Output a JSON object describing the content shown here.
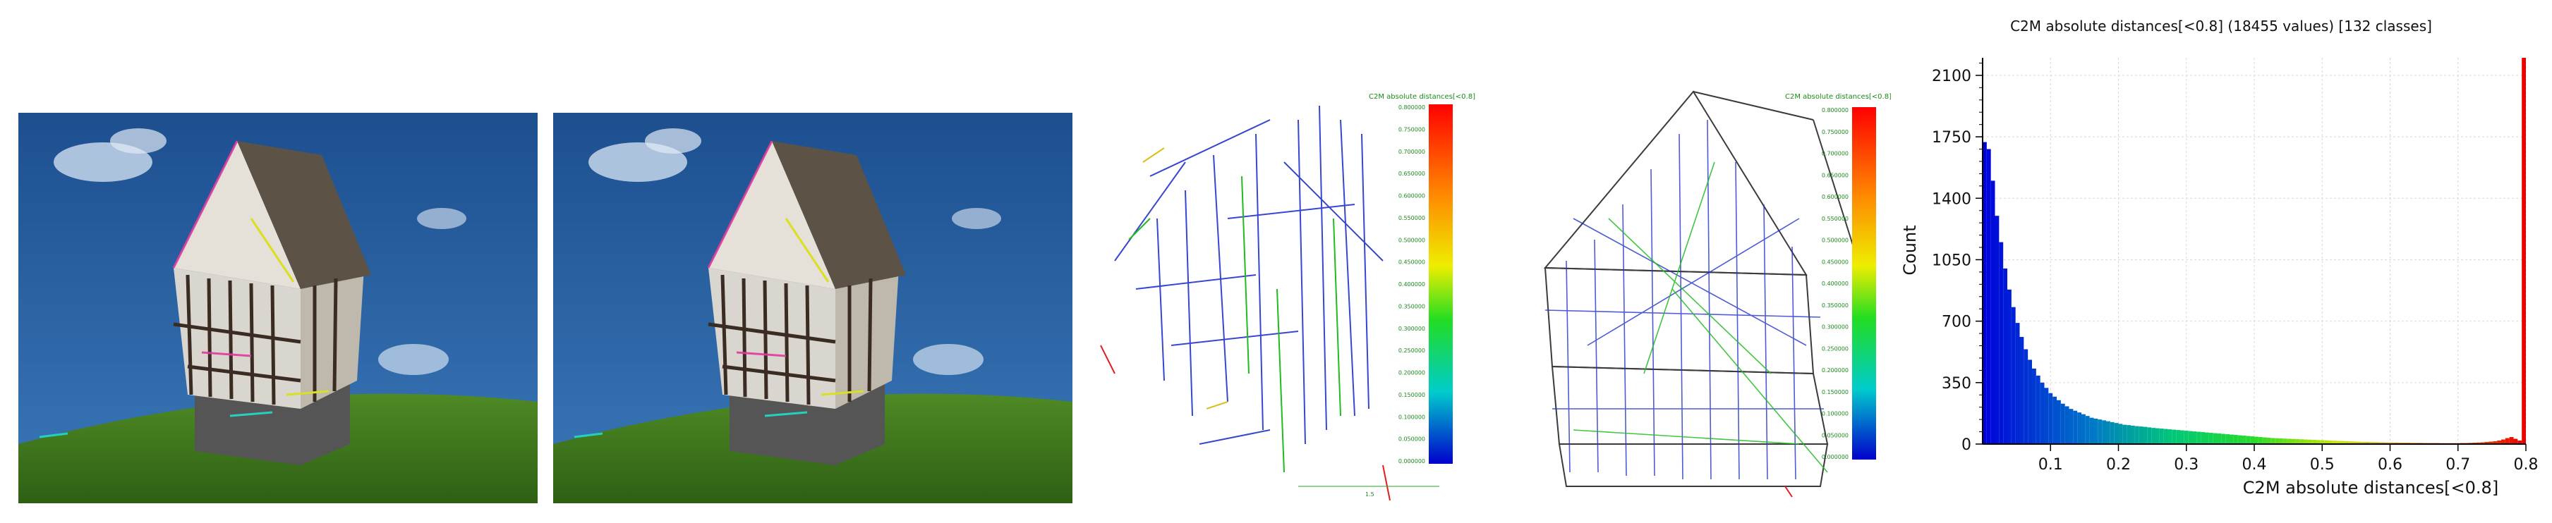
{
  "colorbar": {
    "title": "C2M absolute distances[<0.8]",
    "labels_a": [
      "0.800000",
      "0.750000",
      "0.700000",
      "0.650000",
      "0.600000",
      "0.550000",
      "0.500000",
      "0.450000",
      "0.400000",
      "0.350000",
      "0.300000",
      "0.250000",
      "0.200000",
      "0.150000",
      "0.100000",
      "0.050000",
      "0.000000"
    ],
    "labels_b": [
      "0.800000",
      "0.750000",
      "0.700000",
      "0.650000",
      "0.600000",
      "0.550000",
      "0.500000",
      "0.450000",
      "0.400000",
      "0.350000",
      "0.300000",
      "0.250000",
      "0.200000",
      "0.150000",
      "0.100000",
      "0.050000",
      "0.000000"
    ],
    "scale_label": "1.5"
  },
  "chart_data": {
    "type": "bar",
    "title": "C2M absolute distances[<0.8] (18455 values)  [132 classes]",
    "xlabel": "C2M absolute distances[<0.8]",
    "ylabel": "Count",
    "xlim": [
      0,
      0.8
    ],
    "ylim": [
      0,
      2200
    ],
    "xticks": [
      "0.1",
      "0.2",
      "0.3",
      "0.4",
      "0.5",
      "0.6",
      "0.7",
      "0.8"
    ],
    "yticks": [
      "0",
      "350",
      "700",
      "1050",
      "1400",
      "1750",
      "2100"
    ],
    "grid": true,
    "bins": 132,
    "values": [
      1720,
      1680,
      1500,
      1300,
      1150,
      1000,
      880,
      780,
      690,
      610,
      540,
      480,
      430,
      390,
      350,
      320,
      290,
      270,
      250,
      230,
      215,
      200,
      190,
      180,
      170,
      160,
      150,
      145,
      140,
      135,
      130,
      125,
      120,
      115,
      110,
      108,
      105,
      102,
      100,
      98,
      95,
      92,
      90,
      88,
      86,
      84,
      82,
      80,
      78,
      76,
      74,
      72,
      70,
      68,
      66,
      64,
      62,
      60,
      58,
      56,
      54,
      52,
      50,
      48,
      46,
      44,
      42,
      40,
      38,
      36,
      34,
      33,
      32,
      31,
      30,
      29,
      28,
      27,
      26,
      25,
      24,
      23,
      22,
      21,
      20,
      19,
      18,
      17,
      16,
      15,
      14,
      13,
      12,
      12,
      11,
      11,
      10,
      10,
      9,
      9,
      9,
      8,
      8,
      8,
      7,
      7,
      7,
      6,
      6,
      6,
      6,
      5,
      5,
      5,
      5,
      5,
      6,
      6,
      7,
      8,
      9,
      10,
      12,
      14,
      16,
      20,
      26,
      34,
      40,
      30,
      20,
      2200
    ]
  }
}
